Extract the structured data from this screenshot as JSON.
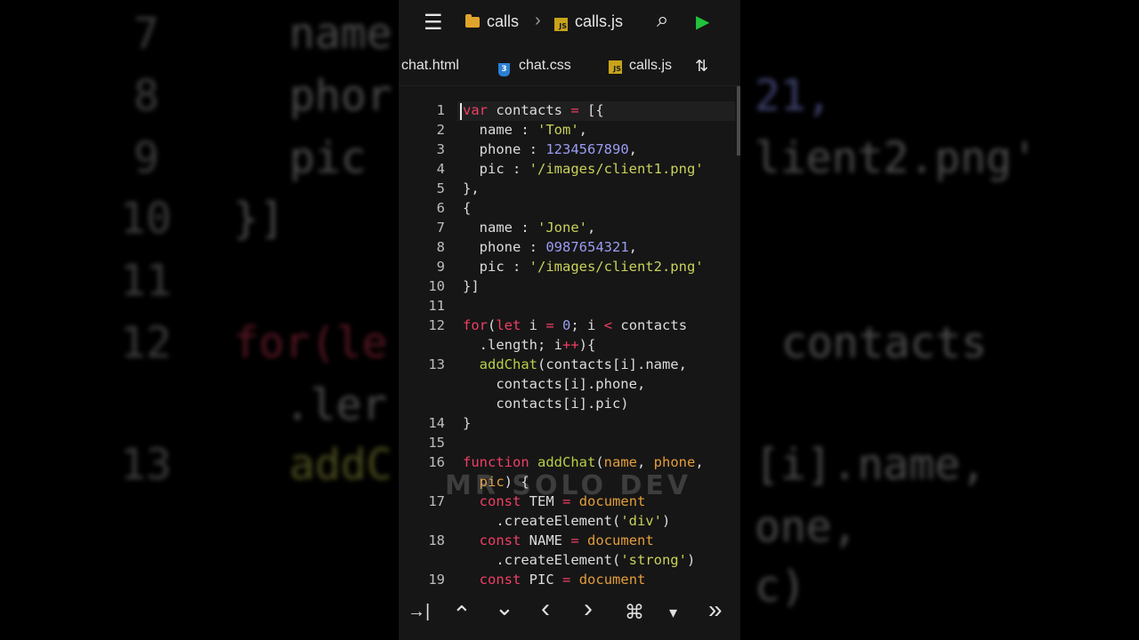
{
  "topbar": {
    "folder": "calls",
    "breadcrumb_sep": "›",
    "file": "calls.js"
  },
  "tabs": [
    {
      "label": "chat.html"
    },
    {
      "label": "chat.css"
    },
    {
      "label": "calls.js"
    }
  ],
  "icons": {
    "menu": "☰",
    "search": "⌕",
    "run": "▶",
    "sort": "⇅",
    "js_badge": "JS",
    "css_badge": "3"
  },
  "colors": {
    "keyword": "#ee3f64",
    "string": "#c9d15a",
    "number": "#9a9cf2",
    "function": "#b6cf45",
    "param": "#e49d3a",
    "run": "#22c33a"
  },
  "code": {
    "line_numbers": [
      "1",
      "2",
      "3",
      "4",
      "5",
      "6",
      "7",
      "8",
      "9",
      "10",
      "11",
      "12",
      "13",
      "14",
      "15",
      "16",
      "17",
      "18",
      "19"
    ],
    "rows": [
      [
        {
          "t": "var",
          "c": "k"
        },
        {
          "t": " contacts "
        },
        {
          "t": "=",
          "c": "o"
        },
        {
          "t": " [{"
        }
      ],
      [
        {
          "t": "  name : "
        },
        {
          "t": "'Tom'",
          "c": "s"
        },
        {
          "t": ","
        }
      ],
      [
        {
          "t": "  phone : "
        },
        {
          "t": "1234567890",
          "c": "n"
        },
        {
          "t": ","
        }
      ],
      [
        {
          "t": "  pic : "
        },
        {
          "t": "'/images/client1.png'",
          "c": "s"
        }
      ],
      [
        {
          "t": "},"
        }
      ],
      [
        {
          "t": "{"
        }
      ],
      [
        {
          "t": "  name : "
        },
        {
          "t": "'Jone'",
          "c": "s"
        },
        {
          "t": ","
        }
      ],
      [
        {
          "t": "  phone : "
        },
        {
          "t": "0987654321",
          "c": "n"
        },
        {
          "t": ","
        }
      ],
      [
        {
          "t": "  pic : "
        },
        {
          "t": "'/images/client2.png'",
          "c": "s"
        }
      ],
      [
        {
          "t": "}]"
        }
      ],
      [],
      [
        {
          "t": "for",
          "c": "k"
        },
        {
          "t": "("
        },
        {
          "t": "let",
          "c": "k"
        },
        {
          "t": " i "
        },
        {
          "t": "=",
          "c": "o"
        },
        {
          "t": " "
        },
        {
          "t": "0",
          "c": "n"
        },
        {
          "t": "; i "
        },
        {
          "t": "<",
          "c": "o"
        },
        {
          "t": " contacts"
        }
      ],
      [
        {
          "t": "  .length; i"
        },
        {
          "t": "++",
          "c": "o"
        },
        {
          "t": "){"
        }
      ],
      [
        {
          "t": "  "
        },
        {
          "t": "addChat",
          "c": "f"
        },
        {
          "t": "(contacts[i].name,"
        }
      ],
      [
        {
          "t": "    contacts[i].phone,"
        }
      ],
      [
        {
          "t": "    contacts[i].pic)"
        }
      ],
      [
        {
          "t": "}"
        }
      ],
      [],
      [
        {
          "t": "function",
          "c": "k"
        },
        {
          "t": " "
        },
        {
          "t": "addChat",
          "c": "f"
        },
        {
          "t": "("
        },
        {
          "t": "name",
          "c": "p"
        },
        {
          "t": ", "
        },
        {
          "t": "phone",
          "c": "p"
        },
        {
          "t": ","
        }
      ],
      [
        {
          "t": "  "
        },
        {
          "t": "pic",
          "c": "p"
        },
        {
          "t": ") {"
        }
      ],
      [
        {
          "t": "  "
        },
        {
          "t": "const",
          "c": "k"
        },
        {
          "t": " TEM "
        },
        {
          "t": "=",
          "c": "o"
        },
        {
          "t": " "
        },
        {
          "t": "document",
          "c": "p"
        }
      ],
      [
        {
          "t": "    .createElement("
        },
        {
          "t": "'div'",
          "c": "s"
        },
        {
          "t": ")"
        }
      ],
      [
        {
          "t": "  "
        },
        {
          "t": "const",
          "c": "k"
        },
        {
          "t": " NAME "
        },
        {
          "t": "=",
          "c": "o"
        },
        {
          "t": " "
        },
        {
          "t": "document",
          "c": "p"
        }
      ],
      [
        {
          "t": "    .createElement("
        },
        {
          "t": "'strong'",
          "c": "s"
        },
        {
          "t": ")"
        }
      ],
      [
        {
          "t": "  "
        },
        {
          "t": "const",
          "c": "k"
        },
        {
          "t": " PIC "
        },
        {
          "t": "=",
          "c": "o"
        },
        {
          "t": " "
        },
        {
          "t": "document",
          "c": "p"
        }
      ]
    ]
  },
  "watermark": "MR SOLO DEV",
  "bottombar": {
    "tab_key": "→|",
    "up": "⌃",
    "down": "⌄",
    "left": "‹",
    "right": "›",
    "cmd": "⌘",
    "dropdown": "▾",
    "more": "»"
  },
  "background": {
    "line_numbers": [
      "7",
      "8",
      "9",
      "10",
      "11",
      "12",
      "13"
    ],
    "lines": [
      "name",
      "phor",
      "pic",
      "}]",
      "for(le",
      "  .ler",
      "addC"
    ],
    "right_lines": [
      "21,",
      "lient2.png'",
      "contacts",
      "[i].name,",
      "one,",
      "c)"
    ]
  }
}
